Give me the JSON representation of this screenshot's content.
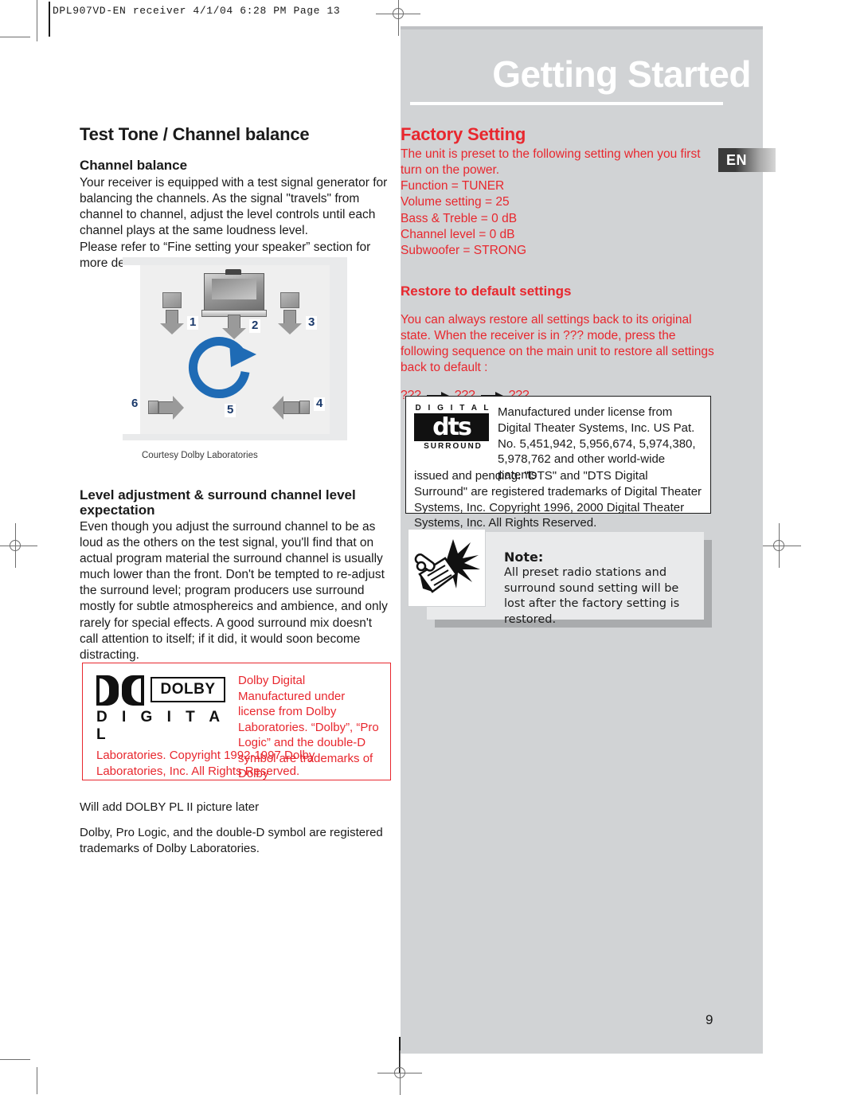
{
  "print_slug": "DPL907VD-EN   receiver   4/1/04  6:28 PM   Page 13",
  "header": {
    "section_title": "Getting Started",
    "language_badge": "EN"
  },
  "colors": {
    "accent_red": "#e8272e",
    "panel_gray": "#d1d3d5",
    "text_black": "#1a1a1a",
    "diagram_number_blue": "#1b3a6b"
  },
  "left_column": {
    "title": "Test Tone / Channel balance",
    "channel_balance": {
      "heading": "Channel balance",
      "paragraph_1": "Your receiver is equipped with a test signal generator for balancing the channels. As the signal \"travels\" from channel to channel, adjust the level controls until each channel plays at the same loudness level.",
      "paragraph_2": "Please refer to “Fine setting your speaker” section for more details."
    },
    "diagram": {
      "labels": [
        "1",
        "2",
        "3",
        "4",
        "5",
        "6"
      ],
      "caption": "Courtesy Dolby Laboratories"
    },
    "level_adjustment": {
      "heading": "Level adjustment & surround channel level expectation",
      "paragraph": "Even though you adjust the surround channel to be as loud as the others on the test signal, you'll find that on actual program material the surround channel is usually much lower than the front. Don't be tempted to re-adjust the surround level; program producers use surround mostly for subtle atmosphereics and ambience, and only rarely for special effects. A good surround mix doesn't call attention to itself; if it did, it would soon become distracting."
    },
    "dolby_box": {
      "logo_word": "DOLBY",
      "logo_subword": "D I G I T A L",
      "right_text": "Dolby Digital Manufactured under license from Dolby Laboratories. “Dolby”, “Pro Logic” and the double-D symbol are trademarks of Dolby",
      "bottom_text": "Laboratories. Copyright 1992-1997 Dolby Laboratories, Inc. All Rights Reserved."
    },
    "footer_note_1": "Will add DOLBY PL II picture later",
    "footer_note_2": "Dolby, Pro Logic, and the double-D symbol are registered trademarks of Dolby Laboratories."
  },
  "right_column": {
    "factory_setting": {
      "heading": "Factory Setting",
      "intro": "The unit is preset to the following setting when you first turn on the power.",
      "settings": [
        "Function = TUNER",
        "Volume setting = 25",
        "Bass & Treble = 0 dB",
        "Channel level = 0 dB",
        "Subwoofer = STRONG"
      ]
    },
    "restore_defaults": {
      "heading": "Restore to default settings",
      "paragraph": "You can always restore all settings back to its original state. When the receiver is in ??? mode, press the following sequence on the main unit to restore all settings back to default :",
      "sequence": [
        "???",
        "???",
        "???"
      ]
    },
    "dts_box": {
      "logo_top": "D I G I T A L",
      "logo_mark": "dts",
      "logo_bottom": "SURROUND",
      "text_a": "Manufactured under license from Digital Theater Systems, Inc. US Pat. No. 5,451,942, 5,956,674, 5,974,380, 5,978,762 and other world-wide patents",
      "text_b": "issued and pending. \"DTS\" and \"DTS Digital Surround\" are registered trademarks of Digital Theater Systems, Inc. Copyright 1996, 2000 Digital Theater Systems, Inc. All Rights Reserved."
    },
    "note_box": {
      "title": "Note:",
      "text": "All preset radio stations and surround sound setting will be lost after the factory setting is restored."
    }
  },
  "page_number": "9"
}
